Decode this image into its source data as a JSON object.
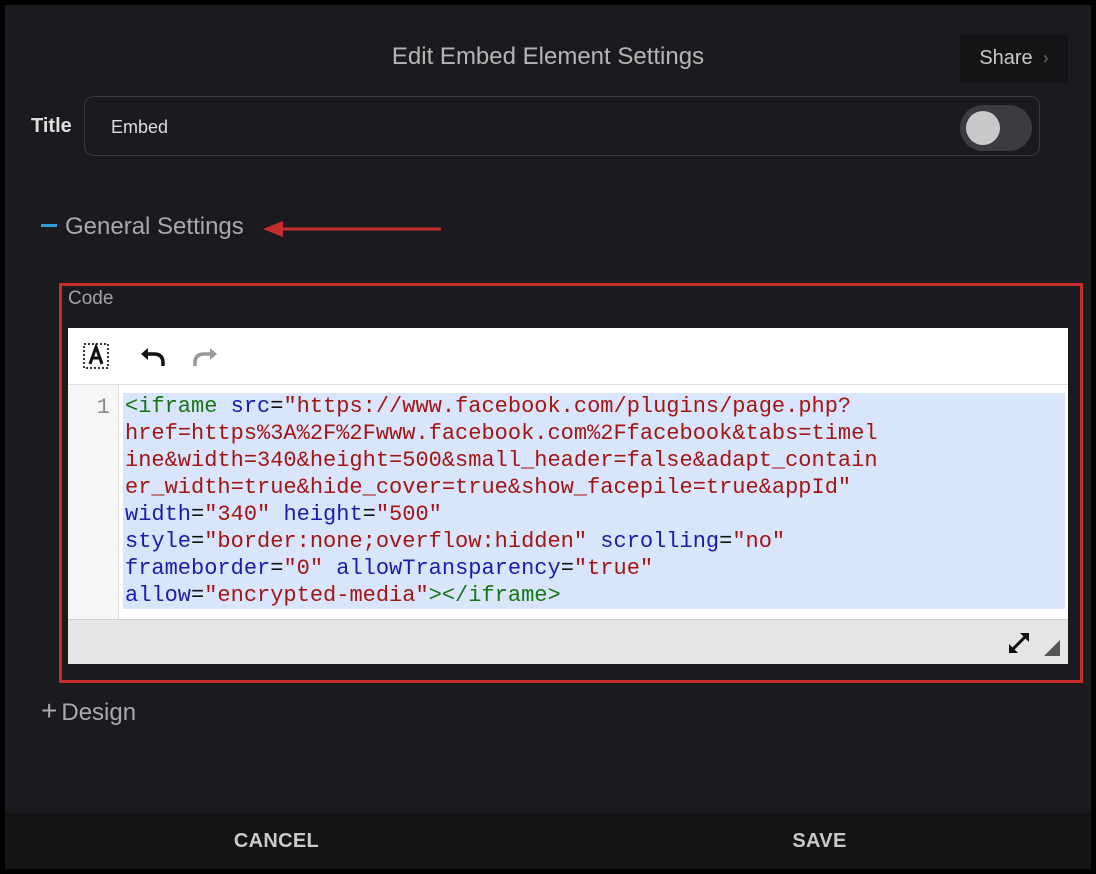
{
  "dialog": {
    "title": "Edit Embed Element Settings",
    "share_label": "Share",
    "share_chevron": "›"
  },
  "title_field": {
    "label": "Title",
    "value": "Embed",
    "toggle_on": false
  },
  "sections": {
    "general": {
      "label": "General Settings",
      "expanded": true
    },
    "design": {
      "label": "Design",
      "expanded": false,
      "prefix": "+"
    }
  },
  "code_field": {
    "label": "Code",
    "line_number": "1",
    "toolbar": [
      "format-icon",
      "undo-icon",
      "redo-icon"
    ],
    "code_tokens": [
      [
        "tag",
        "<iframe"
      ],
      [
        "txt",
        " "
      ],
      [
        "attr",
        "src"
      ],
      [
        "txt",
        "="
      ],
      [
        "str",
        "\"https://www.facebook.com/plugins/page.php?"
      ],
      [
        "br",
        ""
      ],
      [
        "str",
        "href=https%3A%2F%2Fwww.facebook.com%2Ffacebook&tabs=timel"
      ],
      [
        "br",
        ""
      ],
      [
        "str",
        "ine&width=340&height=500&small_header=false&adapt_contain"
      ],
      [
        "br",
        ""
      ],
      [
        "str",
        "er_width=true&hide_cover=true&show_facepile=true&appId\""
      ],
      [
        "br",
        ""
      ],
      [
        "attr",
        "width"
      ],
      [
        "txt",
        "="
      ],
      [
        "str",
        "\"340\""
      ],
      [
        "txt",
        " "
      ],
      [
        "attr",
        "height"
      ],
      [
        "txt",
        "="
      ],
      [
        "str",
        "\"500\""
      ],
      [
        "br",
        ""
      ],
      [
        "attr",
        "style"
      ],
      [
        "txt",
        "="
      ],
      [
        "str",
        "\"border:none;overflow:hidden\""
      ],
      [
        "txt",
        " "
      ],
      [
        "attr",
        "scrolling"
      ],
      [
        "txt",
        "="
      ],
      [
        "str",
        "\"no\""
      ],
      [
        "br",
        ""
      ],
      [
        "attr",
        "frameborder"
      ],
      [
        "txt",
        "="
      ],
      [
        "str",
        "\"0\""
      ],
      [
        "txt",
        " "
      ],
      [
        "attr",
        "allowTransparency"
      ],
      [
        "txt",
        "="
      ],
      [
        "str",
        "\"true\""
      ],
      [
        "br",
        ""
      ],
      [
        "attr",
        "allow"
      ],
      [
        "txt",
        "="
      ],
      [
        "str",
        "\"encrypted-media\""
      ],
      [
        "tag",
        "></iframe>"
      ]
    ]
  },
  "footer": {
    "cancel_label": "CANCEL",
    "save_label": "SAVE"
  },
  "colors": {
    "annotation_red": "#c62e2e",
    "accent_blue": "#2f9bd8",
    "dialog_bg": "#1b1b1f"
  }
}
